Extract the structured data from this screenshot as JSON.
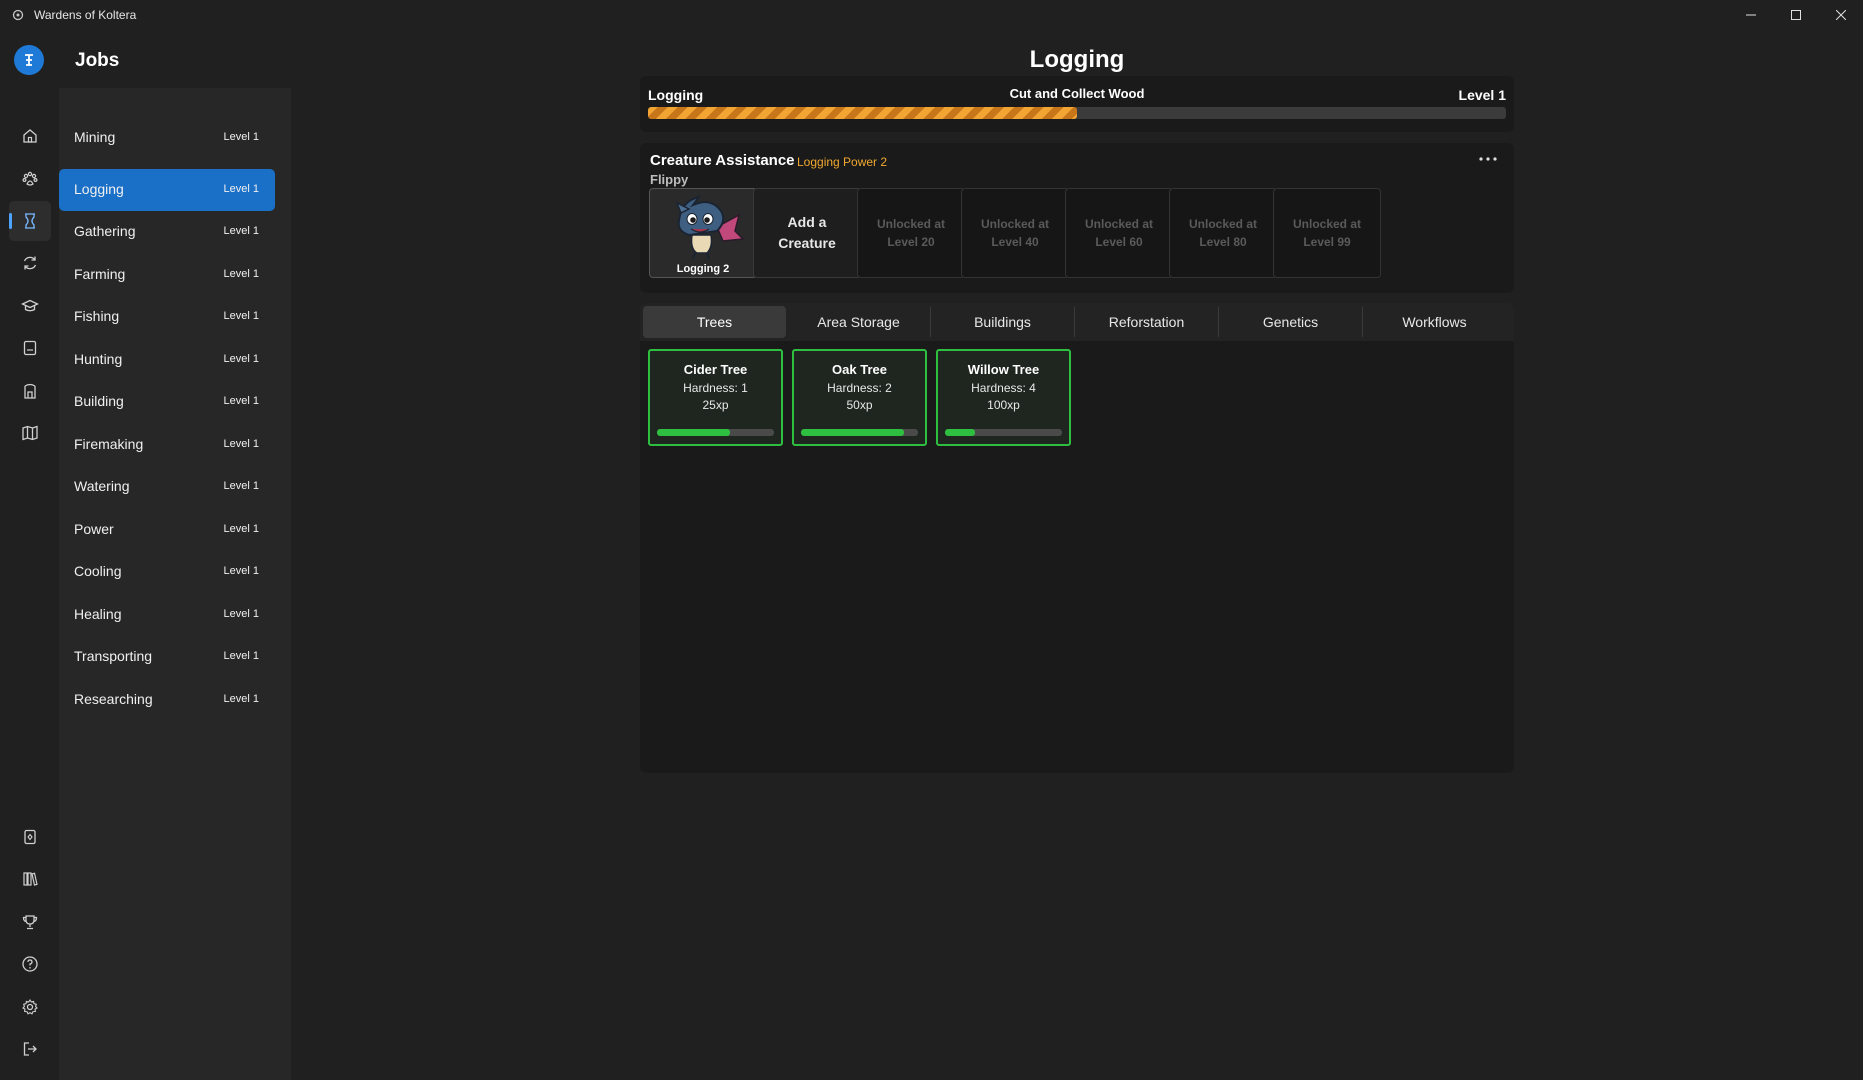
{
  "window": {
    "title": "Wardens of Koltera"
  },
  "rail": {
    "top_icons": [
      "home-icon",
      "paw-icon",
      "hourglass-icon",
      "refresh-icon",
      "graduation-cap-icon",
      "note-icon",
      "backpack-icon",
      "map-icon"
    ],
    "bottom_icons": [
      "card-icon",
      "library-icon",
      "trophy-icon",
      "help-icon",
      "gear-icon",
      "sign-out-icon"
    ],
    "active": "hourglass-icon"
  },
  "jobs": {
    "header": "Jobs",
    "items": [
      {
        "label": "Mining",
        "level": "Level 1"
      },
      {
        "label": "Logging",
        "level": "Level 1",
        "active": true
      },
      {
        "label": "Gathering",
        "level": "Level 1"
      },
      {
        "label": "Farming",
        "level": "Level 1"
      },
      {
        "label": "Fishing",
        "level": "Level 1"
      },
      {
        "label": "Hunting",
        "level": "Level 1"
      },
      {
        "label": "Building",
        "level": "Level 1"
      },
      {
        "label": "Firemaking",
        "level": "Level 1"
      },
      {
        "label": "Watering",
        "level": "Level 1"
      },
      {
        "label": "Power",
        "level": "Level 1"
      },
      {
        "label": "Cooling",
        "level": "Level 1"
      },
      {
        "label": "Healing",
        "level": "Level 1"
      },
      {
        "label": "Transporting",
        "level": "Level 1"
      },
      {
        "label": "Researching",
        "level": "Level 1"
      }
    ]
  },
  "main": {
    "title": "Logging",
    "progress": {
      "job": "Logging",
      "task": "Cut and Collect Wood",
      "level": "Level 1",
      "fraction": 0.5,
      "color": "#f2a533"
    },
    "creature_assistance": {
      "title": "Creature Assistance",
      "power": "Logging Power 2",
      "creature_name": "Flippy",
      "creature_label": "Logging 2",
      "add_label": "Add a Creature",
      "locked_slots": [
        {
          "line1": "Unlocked at",
          "line2": "Level 20"
        },
        {
          "line1": "Unlocked at",
          "line2": "Level 40"
        },
        {
          "line1": "Unlocked at",
          "line2": "Level 60"
        },
        {
          "line1": "Unlocked at",
          "line2": "Level 80"
        },
        {
          "line1": "Unlocked at",
          "line2": "Level 99"
        }
      ]
    },
    "tabs": [
      "Trees",
      "Area Storage",
      "Buildings",
      "Reforstation",
      "Genetics",
      "Workflows"
    ],
    "active_tab": "Trees",
    "trees": [
      {
        "name": "Cider Tree",
        "hardness": "Hardness: 1",
        "xp": "25xp",
        "progress": 0.62
      },
      {
        "name": "Oak Tree",
        "hardness": "Hardness: 2",
        "xp": "50xp",
        "progress": 0.88
      },
      {
        "name": "Willow Tree",
        "hardness": "Hardness: 4",
        "xp": "100xp",
        "progress": 0.26
      }
    ],
    "accent_green": "#2fbf40"
  }
}
